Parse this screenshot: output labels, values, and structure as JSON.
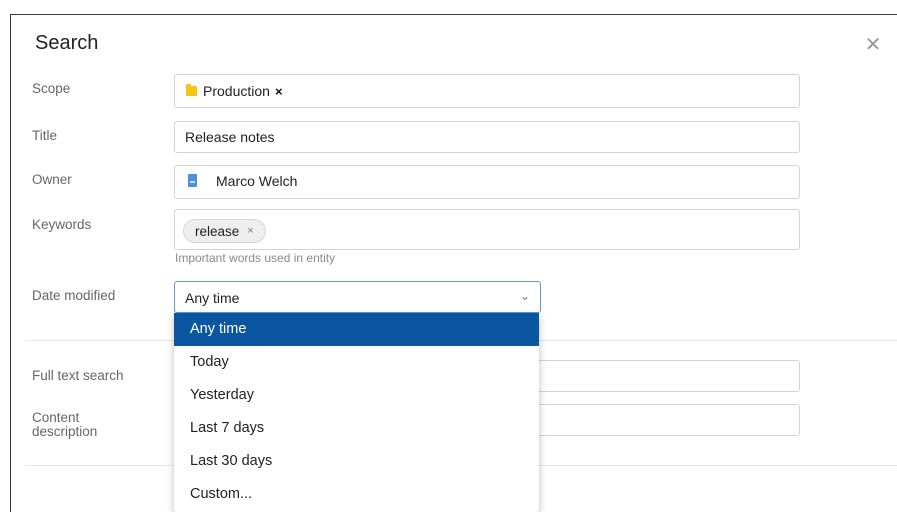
{
  "dialog": {
    "title": "Search",
    "close_icon": "close-icon"
  },
  "form": {
    "scope": {
      "label": "Scope",
      "chip": "Production",
      "chip_remove": "×"
    },
    "title": {
      "label": "Title",
      "value": "Release notes"
    },
    "owner": {
      "label": "Owner",
      "value": "Marco Welch"
    },
    "keywords": {
      "label": "Keywords",
      "chip": "release",
      "chip_remove": "×",
      "hint": "Important words used in entity"
    },
    "date_modified": {
      "label": "Date modified",
      "selected": "Any time",
      "chevron": "⌄"
    },
    "full_text_search": {
      "label": "Full text search",
      "value": ""
    },
    "content_description": {
      "label_line1": "Content",
      "label_line2": "description",
      "value": ""
    }
  },
  "dropdown": {
    "options": [
      "Any time",
      "Today",
      "Yesterday",
      "Last 7 days",
      "Last 30 days",
      "Custom..."
    ],
    "selected_index": 0
  },
  "colors": {
    "accent": "#0a56a1",
    "focus_border": "#5b9bd5",
    "folder": "#f5c518",
    "owner_icon": "#4a90e2"
  }
}
